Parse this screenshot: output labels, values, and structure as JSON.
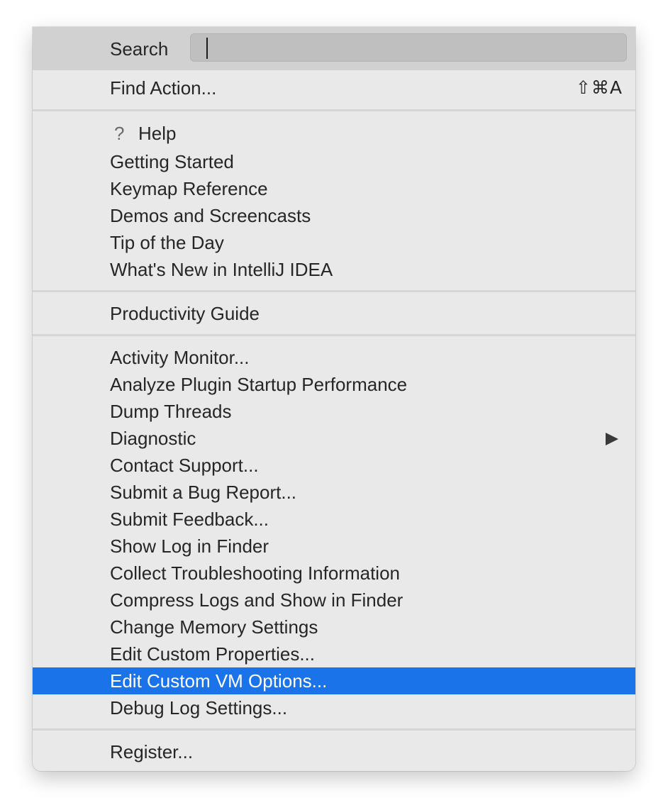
{
  "search": {
    "label": "Search",
    "value": ""
  },
  "find_action": {
    "label": "Find Action...",
    "shortcut": "⇧⌘A"
  },
  "help_group": {
    "help": "Help",
    "items": [
      "Getting Started",
      "Keymap Reference",
      "Demos and Screencasts",
      "Tip of the Day",
      "What's New in IntelliJ IDEA"
    ]
  },
  "productivity_guide": "Productivity Guide",
  "diagnostics_group": {
    "items": [
      "Activity Monitor...",
      "Analyze Plugin Startup Performance",
      "Dump Threads",
      "Diagnostic",
      "Contact Support...",
      "Submit a Bug Report...",
      "Submit Feedback...",
      "Show Log in Finder",
      "Collect Troubleshooting Information",
      "Compress Logs and Show in Finder",
      "Change Memory Settings",
      "Edit Custom Properties...",
      "Edit Custom VM Options...",
      "Debug Log Settings..."
    ],
    "selected_item": "Edit Custom VM Options...",
    "submenu_item": "Diagnostic"
  },
  "register": "Register...",
  "colors": {
    "selection": "#1a73e8",
    "menu_background": "#e9e9e9",
    "search_bar_background": "#d1d1d1"
  },
  "icons": {
    "help": "question-mark-icon",
    "submenu": "submenu-arrow-icon"
  }
}
